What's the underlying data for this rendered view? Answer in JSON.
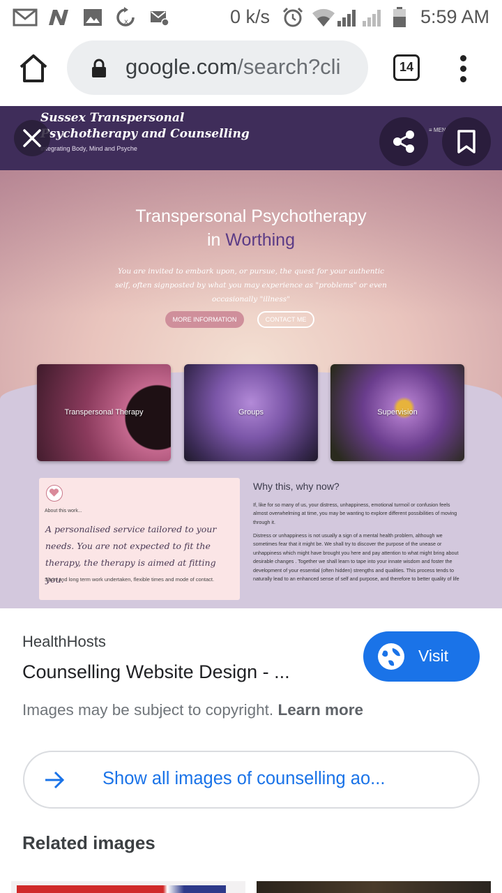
{
  "status_bar": {
    "net_speed": "0 k/s",
    "time": "5:59 AM",
    "icons": [
      "gmail-icon",
      "notification-n-icon",
      "gallery-icon",
      "sync-icon",
      "mail-off-icon",
      "alarm-icon",
      "wifi-icon",
      "signal-icon",
      "signal-icon",
      "battery-icon"
    ]
  },
  "browser": {
    "url_host": "google.com",
    "url_path": "/search?cli",
    "tab_count": "14"
  },
  "preview": {
    "site_title_line1": "Sussex Transpersonal",
    "site_title_line2": "Psychotherapy and Counselling",
    "site_tagline": "Integrating Body, Mind and Psyche",
    "site_menu": "≡ MENU",
    "hero_title": "Transpersonal Psychotherapy",
    "hero_in": "in",
    "hero_place": "Worthing",
    "hero_body": "You are invited to embark upon, or pursue, the quest for your authentic self, often signposted by what you may experience as \"problems\" or even occasionally \"illness\"",
    "btn_more": "MORE INFORMATION",
    "btn_contact": "CONTACT ME",
    "cards": [
      "Transpersonal Therapy",
      "Groups",
      "Supervision"
    ],
    "about_label": "About this work...",
    "script_text": "A personalised service tailored to your needs. You are not expected to fit the therapy, the therapy is aimed at fitting you.",
    "small_text": "Short and long term work undertaken, flexible times and mode of contact.",
    "why_title": "Why this, why now?",
    "why_p1": "If, like for so many of us, your distress, unhappiness, emotional turmoil or confusion feels almost overwhelming at time, you may be wanting to explore different possibilities of moving through it.",
    "why_p2": "Distress or unhappiness is not usually a sign of a mental health problem, although we sometimes fear that it might be. We shall try to discover the purpose of the unease or unhappiness which might have brought you here and pay attention to what might bring about desirable changes . Together we shall learn to tape into your innate wisdom and foster the development of your essential (often hidden) strengths and qualities. This process tends to naturally lead to an enhanced sense of self and purpose, and therefore to better quality of life"
  },
  "result": {
    "source": "HealthHosts",
    "title": "Counselling Website Design - ...",
    "visit_label": "Visit",
    "copyright_text": "Images may be subject to copyright.",
    "learn_more": "Learn more",
    "show_all_label": "Show all images of counselling ao...",
    "related_heading": "Related images"
  }
}
